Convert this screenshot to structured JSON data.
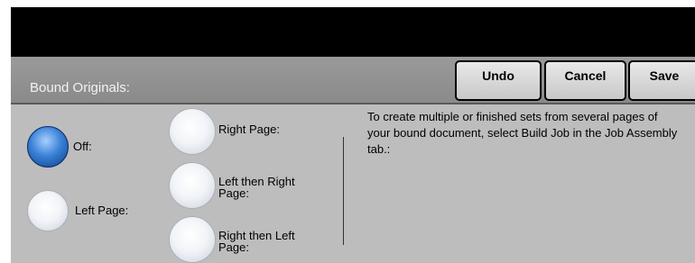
{
  "header": {
    "title": "Bound Originals:",
    "buttons": {
      "undo": "Undo",
      "cancel": "Cancel",
      "save": "Save"
    }
  },
  "options": {
    "off": {
      "label": "Off:",
      "selected": true
    },
    "left_page": {
      "label": "Left Page:",
      "selected": false
    },
    "right_page": {
      "label": "Right Page:",
      "selected": false
    },
    "left_then_right": {
      "label": "Left then Right Page:",
      "selected": false
    },
    "right_then_left": {
      "label": "Right then Left Page:",
      "selected": false
    }
  },
  "info_text": "To create multiple or finished sets from several pages of your bound document, select Build Job in the Job Assembly tab.:",
  "colors": {
    "selected_radio": "#2f6fc4",
    "header_bg": "#929292",
    "panel_bg": "#bdbdbd"
  }
}
